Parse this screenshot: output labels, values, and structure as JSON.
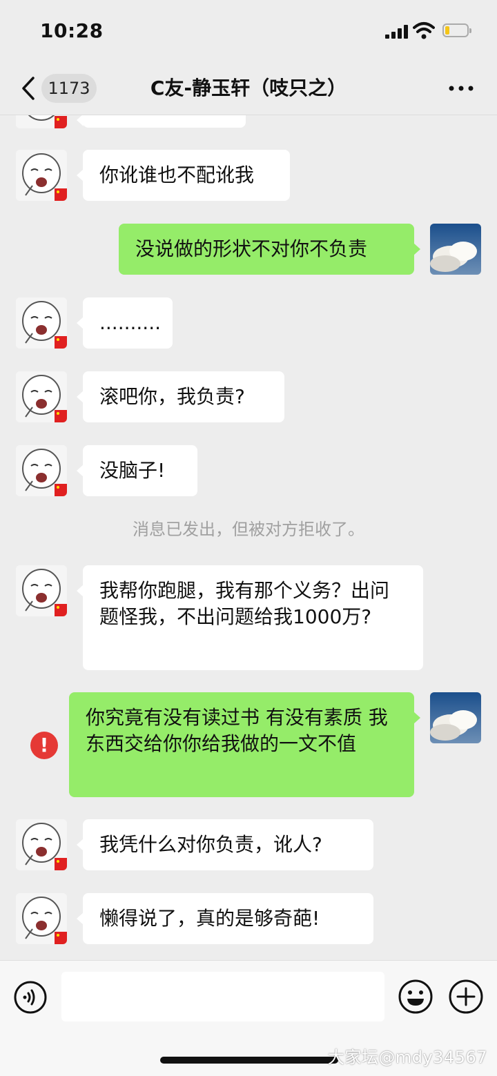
{
  "status_bar": {
    "time": "10:28"
  },
  "nav": {
    "unread_count": "1173",
    "title": "C友-静玉轩（吱只之）"
  },
  "messages": [
    {
      "side": "left",
      "text": "你讹谁也不配讹我"
    },
    {
      "side": "right",
      "text": "没说做的形状不对你不负责"
    },
    {
      "side": "left",
      "text": ".........."
    },
    {
      "side": "left",
      "text": "滚吧你，我负责?"
    },
    {
      "side": "left",
      "text": "没脑子!"
    },
    {
      "side": "system",
      "text": "消息已发出，但被对方拒收了。"
    },
    {
      "side": "left",
      "text": "我帮你跑腿，我有那个义务？出问题怪我，不出问题给我1000万?"
    },
    {
      "side": "right",
      "text": "你究竟有没有读过书 有没有素质 我东西交给你你给我做的一文不值",
      "failed": true
    },
    {
      "side": "left",
      "text": "我凭什么对你负责，讹人?"
    },
    {
      "side": "left",
      "text": "懒得说了，真的是够奇葩!"
    }
  ],
  "input": {
    "placeholder": ""
  },
  "watermark": "大家坛@mdy34567",
  "colors": {
    "background": "#ededed",
    "incoming_bubble": "#ffffff",
    "outgoing_bubble": "#95ec69",
    "error": "#e53935"
  }
}
